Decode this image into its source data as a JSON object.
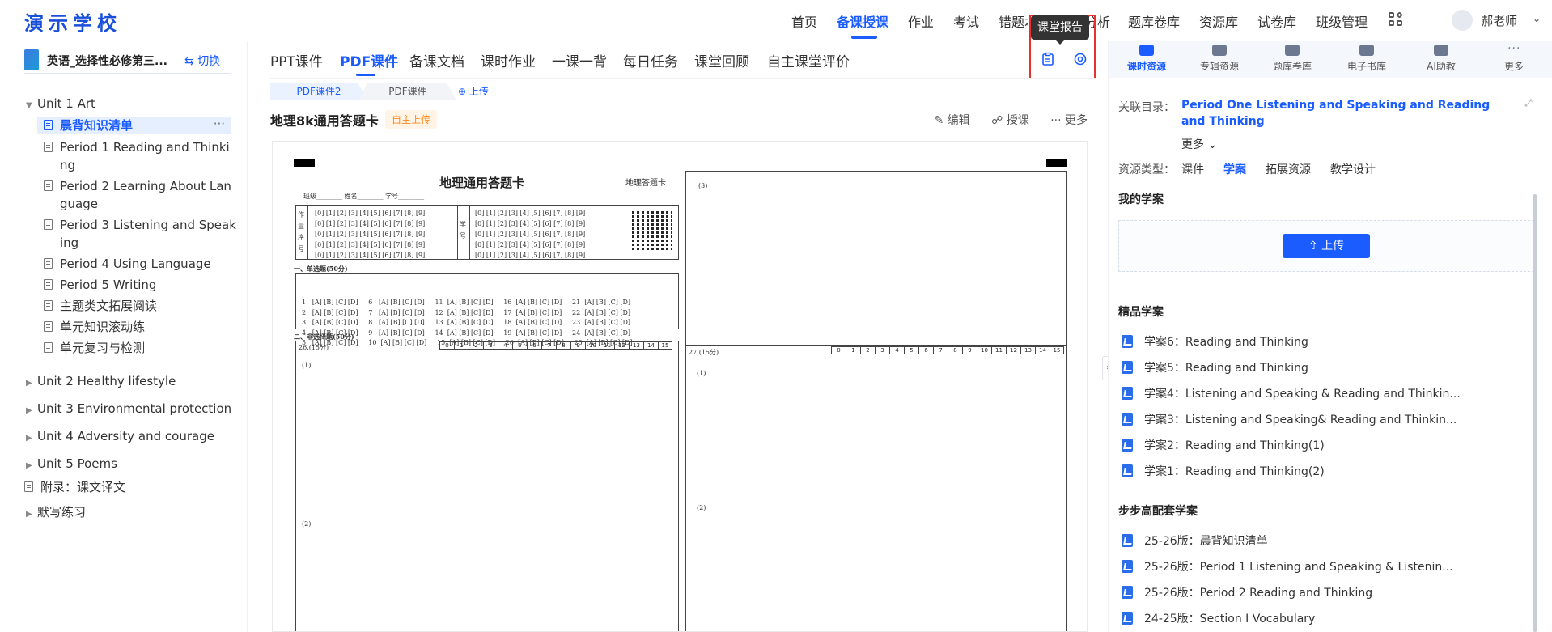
{
  "app": {
    "logo": "演示学校"
  },
  "topnav": {
    "items": [
      "首页",
      "备课授课",
      "作业",
      "考试",
      "错题本",
      "学情分析",
      "题库卷库",
      "资源库",
      "试卷库",
      "班级管理"
    ],
    "active": "备课授课"
  },
  "user": {
    "name": "郝老师"
  },
  "tooltip": {
    "text": "课堂报告"
  },
  "sidebar": {
    "book_title": "英语_选择性必修第三...",
    "switch_label": "切换",
    "unit1": "Unit 1    Art",
    "unit1_items": [
      "晨背知识清单",
      "Period 1    Reading and Thinki",
      "ng",
      "Period 2    Learning About Lan",
      "guage",
      "Period 3    Listening and Speak",
      "ing",
      "Period 4    Using Language",
      "Period 5    Writing",
      "主题类文拓展阅读",
      "单元知识滚动练",
      "单元复习与检测"
    ],
    "units": [
      "Unit 2    Healthy lifestyle",
      "Unit 3    Environmental protection",
      "Unit 4    Adversity and courage",
      "Unit 5    Poems"
    ],
    "appendix": "附录：课文译文",
    "dictation": "默写练习"
  },
  "tabs": {
    "items": [
      "PPT课件",
      "PDF课件",
      "备课文档",
      "课时作业",
      "一课一背",
      "每日任务",
      "课堂回顾",
      "自主课堂评价"
    ],
    "active": "PDF课件"
  },
  "subtabs": {
    "items": [
      "PDF课件2",
      "PDF课件"
    ],
    "upload": "⊕ 上传"
  },
  "document": {
    "title": "地理8k通用答题卡",
    "badge": "自主上传",
    "actions": {
      "edit": "编辑",
      "teach": "授课",
      "more": "更多"
    },
    "sheet": {
      "heading": "地理通用答题卡",
      "corner_label": "地理答题卡",
      "fields": "班级________    姓名________    学号________",
      "section1": "一、单选题(50分)",
      "section2": "二、非选择题(50分)",
      "q26": "26.(15分)",
      "q27": "27.(15分)",
      "part1": "(1)",
      "part2": "(2)",
      "part3": "(3)",
      "score_cells": [
        "0",
        "1",
        "2",
        "3",
        "4",
        "5",
        "6",
        "7",
        "8",
        "9",
        "10",
        "11",
        "12",
        "13",
        "14",
        "15"
      ],
      "id_row": "[0] [1] [2] [3] [4] [5] [6] [7] [8] [9]",
      "mc_rows": [
        "1   [A] [B] [C] [D]     6   [A] [B] [C] [D]     11  [A] [B] [C] [D]     16  [A] [B] [C] [D]     21  [A] [B] [C] [D]",
        "2   [A] [B] [C] [D]     7   [A] [B] [C] [D]     12  [A] [B] [C] [D]     17  [A] [B] [C] [D]     22  [A] [B] [C] [D]",
        "3   [A] [B] [C] [D]     8   [A] [B] [C] [D]     13  [A] [B] [C] [D]     18  [A] [B] [C] [D]     23  [A] [B] [C] [D]",
        "4   [A] [B] [C] [D]     9   [A] [B] [C] [D]     14  [A] [B] [C] [D]     19  [A] [B] [C] [D]     24  [A] [B] [C] [D]",
        "5   [A] [B] [C] [D]     10  [A] [B] [C] [D]     15  [A] [B] [C] [D]     20  [A] [B] [C] [D]     25  [A] [B] [C] [D]"
      ],
      "side1": "作业序号",
      "side2": "学号"
    }
  },
  "right": {
    "tabs": [
      "课时资源",
      "专辑资源",
      "题库卷库",
      "电子书库",
      "AI助教",
      "更多"
    ],
    "active_tab": "课时资源",
    "related_label": "关联目录：",
    "related_link": "Period One Listening and Speaking and Reading and Thinking",
    "more": "更多",
    "type_label": "资源类型：",
    "types": [
      "课件",
      "学案",
      "拓展资源",
      "教学设计"
    ],
    "active_type": "学案",
    "my_section": "我的学案",
    "upload_btn": "上传",
    "featured_section": "精品学案",
    "featured": [
      "学案6：Reading and Thinking",
      "学案5：Reading and Thinking",
      "学案4：Listening and Speaking & Reading and Thinkin...",
      "学案3：Listening and Speaking& Reading and Thinkin...",
      "学案2：Reading and Thinking(1)",
      "学案1：Reading and Thinking(2)"
    ],
    "bbg_section": "步步高配套学案",
    "bbg": [
      "25-26版：晨背知识清单",
      "25-26版：Period 1    Listening and Speaking & Listenin...",
      "25-26版：Period 2    Reading and Thinking",
      "24-25版：Section Ⅰ    Vocabulary"
    ]
  }
}
